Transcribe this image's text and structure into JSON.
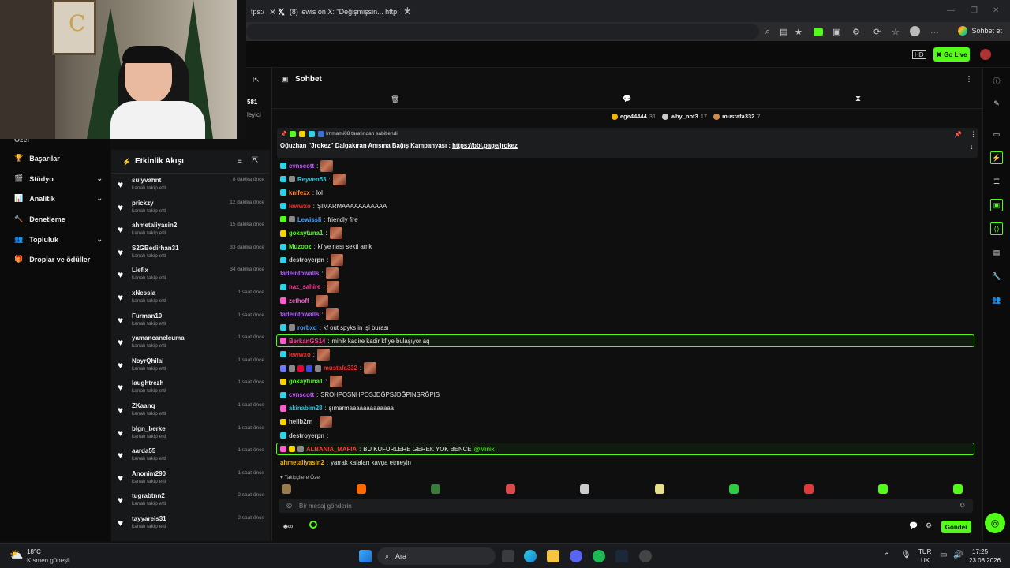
{
  "browser": {
    "tabs": [
      {
        "label": "tps:/",
        "close": "✕"
      },
      {
        "label": "(8) lewis on X: \"Değişmişsin... http:",
        "close": "✕"
      }
    ],
    "new_tab": "+",
    "sohbet_label": "Sohbet et"
  },
  "kick": {
    "go_live": "Go Live",
    "logo_text": "C"
  },
  "left_nav": {
    "items": [
      {
        "label": "Başarılar",
        "icon": "trophy-icon",
        "chevron": false
      },
      {
        "label": "Stüdyo",
        "icon": "clapper-icon",
        "chevron": true
      },
      {
        "label": "Analitik",
        "icon": "chart-icon",
        "chevron": true
      },
      {
        "label": "Denetleme",
        "icon": "hammer-icon",
        "chevron": false
      },
      {
        "label": "Topluluk",
        "icon": "community-icon",
        "chevron": true
      },
      {
        "label": "Droplar ve ödüller",
        "icon": "gift-icon",
        "chevron": false
      }
    ],
    "partial_top": "Özel",
    "follower_partial": "581",
    "follower_label_partial": "leyici"
  },
  "feed": {
    "title": "Etkinlik Akışı",
    "items": [
      {
        "name": "sulyvahnt",
        "sub": "kanalı takip etti",
        "time": "8 dakika önce"
      },
      {
        "name": "prickzy",
        "sub": "kanalı takip etti",
        "time": "12 dakika önce"
      },
      {
        "name": "ahmetaliyasin2",
        "sub": "kanalı takip etti",
        "time": "15 dakika önce"
      },
      {
        "name": "S2GBedirhan31",
        "sub": "kanalı takip etti",
        "time": "33 dakika önce"
      },
      {
        "name": "Liefix",
        "sub": "kanalı takip etti",
        "time": "34 dakika önce"
      },
      {
        "name": "xNessia",
        "sub": "kanalı takip etti",
        "time": "1 saat önce"
      },
      {
        "name": "Furman10",
        "sub": "kanalı takip etti",
        "time": "1 saat önce"
      },
      {
        "name": "yamancanelcuma",
        "sub": "kanalı takip etti",
        "time": "1 saat önce"
      },
      {
        "name": "NoyrQhilal",
        "sub": "kanalı takip etti",
        "time": "1 saat önce"
      },
      {
        "name": "laughtrezh",
        "sub": "kanalı takip etti",
        "time": "1 saat önce"
      },
      {
        "name": "ZKaanq",
        "sub": "kanalı takip etti",
        "time": "1 saat önce"
      },
      {
        "name": "blgn_berke",
        "sub": "kanalı takip etti",
        "time": "1 saat önce"
      },
      {
        "name": "aarda55",
        "sub": "kanalı takip etti",
        "time": "1 saat önce"
      },
      {
        "name": "Anonim290",
        "sub": "kanalı takip etti",
        "time": "1 saat önce"
      },
      {
        "name": "tugrabtnn2",
        "sub": "kanalı takip etti",
        "time": "2 saat önce"
      },
      {
        "name": "tayyareis31",
        "sub": "kanalı takip etti",
        "time": "2 saat önce"
      }
    ]
  },
  "chat": {
    "title": "Sohbet",
    "leaders": [
      {
        "name": "ege44444",
        "count": "31",
        "color": "#f5b400"
      },
      {
        "name": "why_not3",
        "count": "17",
        "color": "#c9c9c9"
      },
      {
        "name": "mustafa332",
        "count": "7",
        "color": "#d08a4b"
      }
    ],
    "pinned": {
      "by": "Immami08 tarafından sabitlendi",
      "text": "Oğuzhan \"Jrokez\" Dalgakıran Anısına Bağış Kampanyası : ",
      "link": "https://bbl.page/jrokez"
    },
    "messages": [
      {
        "user": "cvnscott",
        "color": "#c65cff",
        "text": "",
        "emote": true,
        "badges": [
          "#2bd4e6"
        ]
      },
      {
        "user": "Reyven53",
        "color": "#22c7e0",
        "text": "",
        "emote": true,
        "badges": [
          "#2bd4e6",
          "#888"
        ]
      },
      {
        "user": "knifexx",
        "color": "#ff8a1a",
        "text": "lol",
        "emote": false,
        "badges": [
          "#2bd4e6"
        ]
      },
      {
        "user": "lewwxo",
        "color": "#ff2a2a",
        "text": "ŞIMARMAAAAAAAAAAA",
        "emote": false,
        "badges": [
          "#2bd4e6"
        ]
      },
      {
        "user": "Lewissli",
        "color": "#4ea5ff",
        "text": "friendly fire",
        "emote": false,
        "badges": [
          "#53fc18",
          "#888"
        ]
      },
      {
        "user": "gokaytuna1",
        "color": "#53fc18",
        "text": "",
        "emote": true,
        "badges": [
          "#f5d400"
        ]
      },
      {
        "user": "Muzooz",
        "color": "#53fc18",
        "text": "kf ye nası sekti amk",
        "emote": false,
        "badges": [
          "#2bd4e6"
        ]
      },
      {
        "user": "destroyerpn",
        "color": "#cfcfcf",
        "text": "",
        "emote": true,
        "badges": [
          "#2bd4e6"
        ]
      },
      {
        "user": "fadeintowalls",
        "color": "#b15cff",
        "text": "",
        "emote": true,
        "badges": []
      },
      {
        "user": "naz_sahire",
        "color": "#ff3b9a",
        "text": "",
        "emote": true,
        "badges": [
          "#2bd4e6"
        ]
      },
      {
        "user": "zethoff",
        "color": "#ff5ad1",
        "text": "",
        "emote": true,
        "badges": [
          "#ff5ad1"
        ]
      },
      {
        "user": "fadeintowalls",
        "color": "#b15cff",
        "text": "",
        "emote": true,
        "badges": []
      },
      {
        "user": "rorbxd",
        "color": "#4ea5ff",
        "text": "kf out spyks in işi burası",
        "emote": false,
        "badges": [
          "#2bd4e6",
          "#888"
        ]
      },
      {
        "user": "BerkanGS14",
        "color": "#ff3b9a",
        "text": "minik kadire kadir kf ye bulaşıyor aq",
        "emote": false,
        "badges": [
          "#ff5ad1"
        ],
        "highlight": true
      },
      {
        "user": "lewwxo",
        "color": "#ff2a2a",
        "text": "",
        "emote": true,
        "badges": [
          "#2bd4e6"
        ]
      },
      {
        "user": "mustafa332",
        "color": "#ff2a2a",
        "text": "",
        "emote": true,
        "badges": [
          "#6b7cff",
          "#888",
          "#e03",
          "#3a4bdd",
          "#888"
        ]
      },
      {
        "user": "gokaytuna1",
        "color": "#53fc18",
        "text": "",
        "emote": true,
        "badges": [
          "#f5d400"
        ]
      },
      {
        "user": "cvnscott",
        "color": "#c65cff",
        "text": "SROHPOSNHPOSJDĞPSJDĞPINSRĞPIS",
        "emote": false,
        "badges": [
          "#2bd4e6"
        ]
      },
      {
        "user": "akinabim28",
        "color": "#22c7e0",
        "text": "şımarmaaaaaaaaaaaaa",
        "emote": false,
        "badges": [
          "#ff5ad1"
        ]
      },
      {
        "user": "hellb2rn",
        "color": "#cfcfcf",
        "text": "",
        "emote": true,
        "badges": [
          "#f5d400"
        ]
      },
      {
        "user": "destroyerpn",
        "color": "#cfcfcf",
        "text": "",
        "emote": false,
        "badges": [
          "#2bd4e6"
        ]
      },
      {
        "user": "ALBANIA_MAFIA",
        "color": "#ff3b3b",
        "text": "BU KUFURLERE GEREK YOK BENCE ",
        "mention": "@Minik",
        "emote": false,
        "badges": [
          "#ff5ad1",
          "#f5d400",
          "#888"
        ],
        "highlight": true
      },
      {
        "user": "ahmetaliyasin2",
        "color": "#f5b400",
        "text": "yarrak kafaları kavga etmeyin",
        "emote": false,
        "badges": []
      }
    ],
    "emote_section": "Takipçilere Özel",
    "input_placeholder": "Bir mesaj gönderin",
    "send_label": "Gönder"
  },
  "taskbar": {
    "weather_temp": "18°C",
    "weather_text": "Kısmen güneşli",
    "search_label": "Ara",
    "lang_top": "TUR",
    "lang_bottom": "UK",
    "time": "17:25",
    "date": "23.08.2026"
  }
}
